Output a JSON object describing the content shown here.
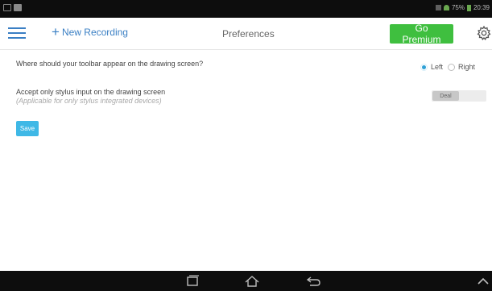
{
  "status_bar": {
    "time": "20:39",
    "battery_percent": "75%"
  },
  "toolbar": {
    "new_recording_label": "New Recording",
    "title": "Preferences",
    "premium_label": "Go Premium"
  },
  "preferences": {
    "toolbar_position": {
      "question": "Where should your toolbar appear on the drawing screen?",
      "options": [
        "Left",
        "Right"
      ],
      "selected": "Left"
    },
    "stylus_only": {
      "question": "Accept only stylus input on the drawing screen",
      "hint": "(Applicable for only stylus integrated devices)",
      "state_label": "Deal"
    },
    "save_label": "Save"
  },
  "colors": {
    "accent_blue": "#3a7fc4",
    "premium_green": "#3fbf3f",
    "save_blue": "#3fb8e6",
    "system_bar": "#0d0d0d"
  },
  "icons": {
    "menu": "hamburger-menu-icon",
    "add": "plus-icon",
    "settings": "gear-icon",
    "nav_recent": "recent-apps-icon",
    "nav_home": "home-icon",
    "nav_back": "back-icon",
    "nav_up": "chevron-up-icon"
  }
}
